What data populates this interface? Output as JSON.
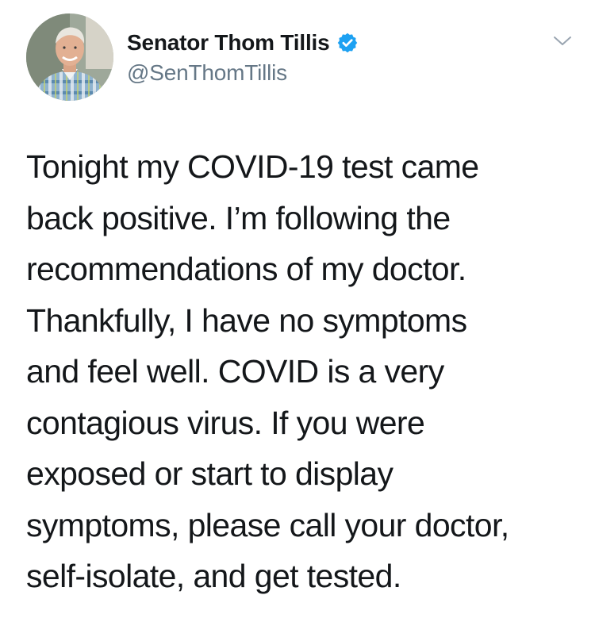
{
  "author": {
    "display_name": "Senator Thom Tillis",
    "handle": "@SenThomTillis",
    "verified": true,
    "avatar_icon": "profile-photo",
    "verified_icon": "verified-badge-icon"
  },
  "menu_icon": "chevron-down-icon",
  "tweet": {
    "text": "Tonight my COVID-19 test came\nback positive. I’m following the\nrecommendations of my doctor.\nThankfully, I have no symptoms\nand feel well. COVID is a very\ncontagious virus. If you were\nexposed or start to display\nsymptoms, please call your doctor,\nself-isolate, and get tested."
  },
  "colors": {
    "text_primary": "#14171a",
    "text_secondary": "#657786",
    "verified_blue": "#1da1f2",
    "chevron": "#9aa5b1",
    "background": "#ffffff"
  }
}
